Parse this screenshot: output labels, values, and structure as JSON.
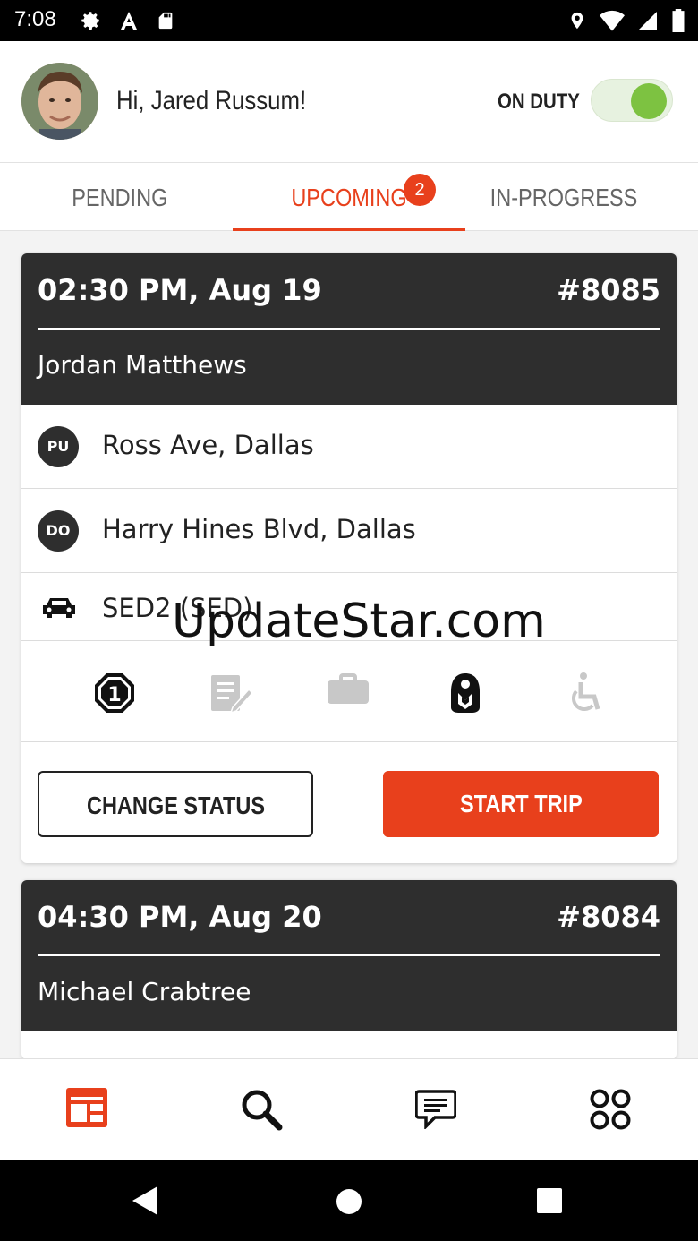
{
  "status_bar": {
    "time": "7:08",
    "left_icons": [
      "gear-icon",
      "a-icon",
      "sd-card-icon"
    ],
    "right_icons": [
      "location-icon",
      "wifi-icon",
      "signal-icon",
      "battery-icon"
    ]
  },
  "header": {
    "greeting": "Hi, Jared Russum!",
    "duty_label": "ON DUTY",
    "duty_on": true,
    "accent_green": "#7dc241"
  },
  "tabs": [
    {
      "label": "PENDING",
      "active": false
    },
    {
      "label": "UPCOMING",
      "active": true,
      "badge": "2"
    },
    {
      "label": "IN-PROGRESS",
      "active": false
    }
  ],
  "accent_color": "#e8401c",
  "trips": [
    {
      "when": "02:30 PM, Aug 19",
      "number": "#8085",
      "passenger": "Jordan Matthews",
      "pickup_tag": "PU",
      "pickup": "Ross Ave, Dallas",
      "dropoff_tag": "DO",
      "dropoff": "Harry Hines Blvd, Dallas",
      "vehicle": "SED2 (SED)",
      "feature_icons": [
        "passenger-count-1-icon",
        "notes-icon",
        "luggage-icon",
        "child-seat-icon",
        "wheelchair-icon"
      ],
      "change_status_label": "CHANGE STATUS",
      "start_trip_label": "START TRIP"
    },
    {
      "when": "04:30 PM, Aug 20",
      "number": "#8084",
      "passenger": "Michael Crabtree"
    }
  ],
  "watermark": "UpdateStar.com",
  "bottom_nav": [
    "trips-icon",
    "search-icon",
    "messages-icon",
    "apps-icon"
  ],
  "system_nav": [
    "back-icon",
    "home-icon",
    "recents-icon"
  ]
}
